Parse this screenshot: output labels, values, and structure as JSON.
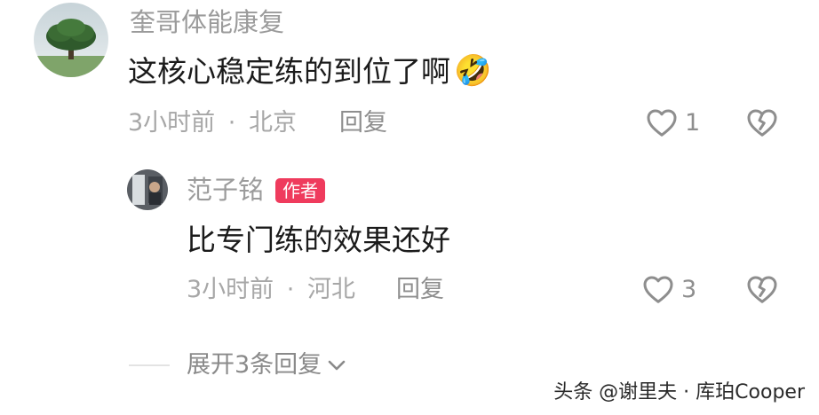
{
  "comments": [
    {
      "username": "奎哥体能康复",
      "text": "这核心稳定练的到位了啊",
      "emoji": "🤣",
      "time": "3小时前",
      "location": "北京",
      "reply_label": "回复",
      "likes": "1"
    }
  ],
  "replies": [
    {
      "username": "范子铭",
      "badge": "作者",
      "text": "比专门练的效果还好",
      "time": "3小时前",
      "location": "河北",
      "reply_label": "回复",
      "likes": "3"
    }
  ],
  "separator": "·",
  "expand_label": "展开3条回复",
  "watermark": "头条 @谢里夫 · 库珀Cooper",
  "icons": {
    "like": "heart-outline-icon",
    "dislike": "broken-heart-icon",
    "expand": "chevron-down-icon"
  },
  "colors": {
    "author_badge": "#ef3b5d",
    "text_primary": "#1b1b1b",
    "text_secondary": "#9b9b9b"
  }
}
